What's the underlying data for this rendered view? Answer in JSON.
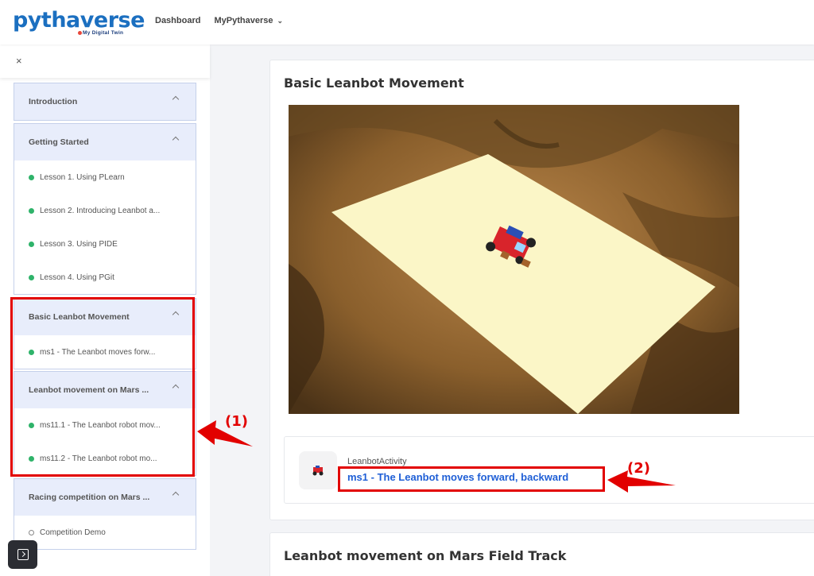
{
  "header": {
    "logo_text": "pythaverse",
    "logo_tagline": "My Digital Twin",
    "nav": [
      {
        "label": "Dashboard"
      },
      {
        "label": "MyPythaverse"
      }
    ]
  },
  "sidebar": {
    "close_symbol": "×",
    "sections": [
      {
        "title": "Introduction",
        "items": []
      },
      {
        "title": "Getting Started",
        "items": [
          {
            "label": "Lesson 1. Using PLearn",
            "status": "done"
          },
          {
            "label": "Lesson 2. Introducing Leanbot a...",
            "status": "done"
          },
          {
            "label": "Lesson 3. Using PIDE",
            "status": "done"
          },
          {
            "label": "Lesson 4. Using PGit",
            "status": "done"
          }
        ]
      },
      {
        "title": "Basic Leanbot Movement",
        "items": [
          {
            "label": "ms1 - The Leanbot moves forw...",
            "status": "done"
          }
        ]
      },
      {
        "title": "Leanbot movement on Mars ...",
        "items": [
          {
            "label": "ms11.1 - The Leanbot robot mov...",
            "status": "done"
          },
          {
            "label": "ms11.2 - The Leanbot robot mo...",
            "status": "done"
          }
        ]
      },
      {
        "title": "Racing competition on Mars ...",
        "items": [
          {
            "label": "Competition Demo",
            "status": "pending"
          }
        ]
      }
    ]
  },
  "main": {
    "section1_title": "Basic Leanbot Movement",
    "activity": {
      "type": "LeanbotActivity",
      "title": "ms1 - The Leanbot moves forward, backward"
    },
    "section2_title": "Leanbot movement on Mars Field Track"
  },
  "annotations": {
    "label1": "(1)",
    "label2": "(2)"
  },
  "colors": {
    "accent": "#1f5fd6",
    "highlight": "#e20000",
    "done_dot": "#2fb36a",
    "section_header_bg": "#e8edfb"
  }
}
